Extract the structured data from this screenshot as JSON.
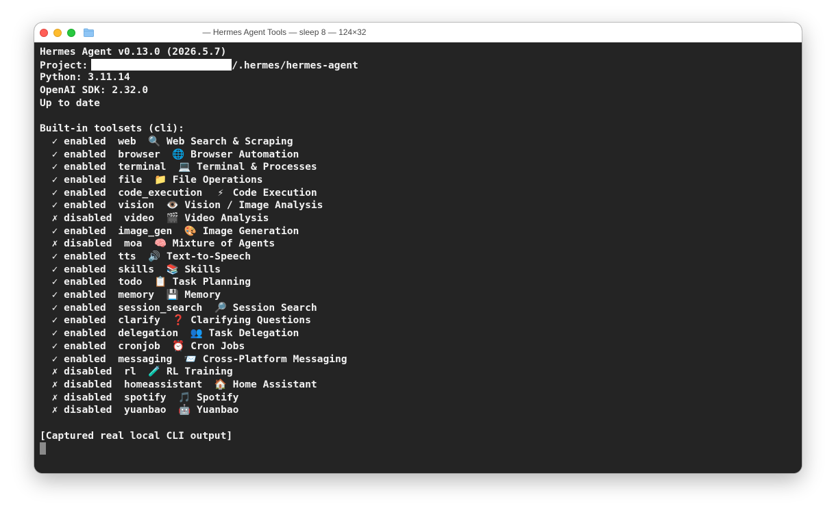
{
  "window": {
    "title": "— Hermes Agent Tools — sleep 8 — 124×32"
  },
  "header": {
    "version_line": "Hermes Agent v0.13.0 (2026.5.7)",
    "project_label": "Project:",
    "project_path_suffix": "/.hermes/hermes-agent",
    "python_line": "Python: 3.11.14",
    "sdk_line": "OpenAI SDK: 2.32.0",
    "status_line": "Up to date"
  },
  "toolsets": {
    "heading": "Built-in toolsets (cli):",
    "items": [
      {
        "mark": "✓",
        "state": "enabled",
        "name": "web",
        "icon": "🔍",
        "desc": "Web Search & Scraping"
      },
      {
        "mark": "✓",
        "state": "enabled",
        "name": "browser",
        "icon": "🌐",
        "desc": "Browser Automation"
      },
      {
        "mark": "✓",
        "state": "enabled",
        "name": "terminal",
        "icon": "💻",
        "desc": "Terminal & Processes"
      },
      {
        "mark": "✓",
        "state": "enabled",
        "name": "file",
        "icon": "📁",
        "desc": "File Operations"
      },
      {
        "mark": "✓",
        "state": "enabled",
        "name": "code_execution",
        "icon": "⚡",
        "desc": "Code Execution"
      },
      {
        "mark": "✓",
        "state": "enabled",
        "name": "vision",
        "icon": "👁️",
        "desc": "Vision / Image Analysis"
      },
      {
        "mark": "✗",
        "state": "disabled",
        "name": "video",
        "icon": "🎬",
        "desc": "Video Analysis"
      },
      {
        "mark": "✓",
        "state": "enabled",
        "name": "image_gen",
        "icon": "🎨",
        "desc": "Image Generation"
      },
      {
        "mark": "✗",
        "state": "disabled",
        "name": "moa",
        "icon": "🧠",
        "desc": "Mixture of Agents"
      },
      {
        "mark": "✓",
        "state": "enabled",
        "name": "tts",
        "icon": "🔊",
        "desc": "Text-to-Speech"
      },
      {
        "mark": "✓",
        "state": "enabled",
        "name": "skills",
        "icon": "📚",
        "desc": "Skills"
      },
      {
        "mark": "✓",
        "state": "enabled",
        "name": "todo",
        "icon": "📋",
        "desc": "Task Planning"
      },
      {
        "mark": "✓",
        "state": "enabled",
        "name": "memory",
        "icon": "💾",
        "desc": "Memory"
      },
      {
        "mark": "✓",
        "state": "enabled",
        "name": "session_search",
        "icon": "🔎",
        "desc": "Session Search"
      },
      {
        "mark": "✓",
        "state": "enabled",
        "name": "clarify",
        "icon": "❓",
        "desc": "Clarifying Questions"
      },
      {
        "mark": "✓",
        "state": "enabled",
        "name": "delegation",
        "icon": "👥",
        "desc": "Task Delegation"
      },
      {
        "mark": "✓",
        "state": "enabled",
        "name": "cronjob",
        "icon": "⏰",
        "desc": "Cron Jobs"
      },
      {
        "mark": "✓",
        "state": "enabled",
        "name": "messaging",
        "icon": "📨",
        "desc": "Cross-Platform Messaging"
      },
      {
        "mark": "✗",
        "state": "disabled",
        "name": "rl",
        "icon": "🧪",
        "desc": "RL Training"
      },
      {
        "mark": "✗",
        "state": "disabled",
        "name": "homeassistant",
        "icon": "🏠",
        "desc": "Home Assistant"
      },
      {
        "mark": "✗",
        "state": "disabled",
        "name": "spotify",
        "icon": "🎵",
        "desc": "Spotify"
      },
      {
        "mark": "✗",
        "state": "disabled",
        "name": "yuanbao",
        "icon": "🤖",
        "desc": "Yuanbao"
      }
    ]
  },
  "footer": {
    "note": "[Captured real local CLI output]"
  },
  "colors": {
    "terminal_bg": "#242424",
    "terminal_fg": "#f2f2f2",
    "titlebar_bg": "#ffffff",
    "close": "#ff5f57",
    "minimize": "#febc2e",
    "maximize": "#28c840"
  }
}
